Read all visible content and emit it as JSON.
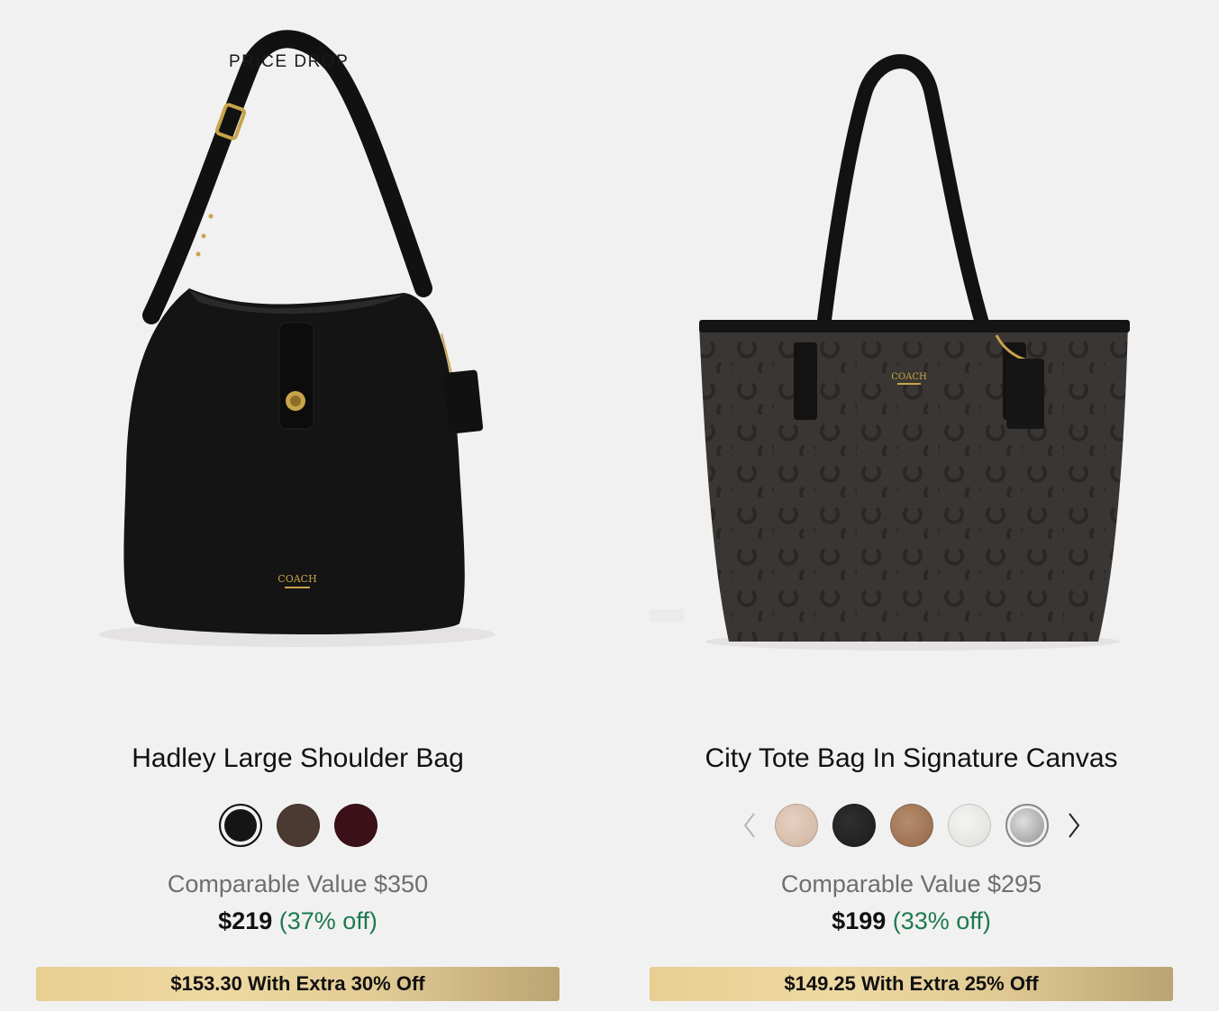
{
  "products": [
    {
      "badge": "PRICE DROP",
      "title": "Hadley Large Shoulder Bag",
      "swatches": [
        {
          "color": "#151515",
          "selected": true
        },
        {
          "color": "#4a3a31",
          "selected": false
        },
        {
          "color": "#3b1019",
          "selected": false
        }
      ],
      "comparable": "Comparable Value $350",
      "price": "$219",
      "discount": "(37% off)",
      "extra": "$153.30 With Extra 30% Off",
      "bag_color": "#131313"
    },
    {
      "title": "City Tote Bag In Signature Canvas",
      "swatches": [
        {
          "color": "#d9bfae",
          "selected": false
        },
        {
          "color": "#242424",
          "selected": false
        },
        {
          "color": "#a3785a",
          "selected": false
        },
        {
          "color": "#ececea",
          "selected": false
        },
        {
          "color": "#a9a9a9",
          "selected": false
        }
      ],
      "comparable": "Comparable Value $295",
      "price": "$199",
      "discount": "(33% off)",
      "extra": "$149.25 With Extra 25% Off",
      "bag_color": "#3a3633"
    }
  ],
  "colors": {
    "background": "#f2f1f1",
    "discount_green": "#1d7a4e",
    "comparable_gray": "#6e6e6e",
    "extra_bar_gold": "#e7cf92"
  },
  "icons": {
    "prev": "chevron-left-icon",
    "next": "chevron-right-icon"
  }
}
